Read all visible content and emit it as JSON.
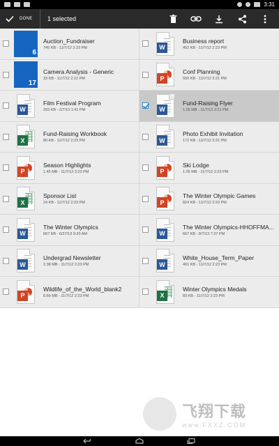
{
  "status_bar": {
    "time": "3:31",
    "icons": [
      "signal-icon",
      "cloud-icon",
      "sync-icon",
      "bluetooth-icon",
      "wifi-icon",
      "battery-icon"
    ]
  },
  "action_bar": {
    "done_label": "DONE",
    "selection_text": "1 selected",
    "actions": [
      "delete-icon",
      "link-icon",
      "download-icon",
      "share-icon",
      "overflow-menu-icon"
    ]
  },
  "files": [
    {
      "name": "Auction_Fundraiser",
      "meta": "745 KB - 11/7/12 2:23 PM",
      "type": "folder",
      "count": "6",
      "checked": false
    },
    {
      "name": "Business report",
      "meta": "452 KB - 11/7/12 2:23 PM",
      "type": "word",
      "checked": false
    },
    {
      "name": "Camera Analysis - Generic",
      "meta": "33 KB - 11/7/12 2:21 PM",
      "type": "folder",
      "count": "17",
      "checked": false
    },
    {
      "name": "Conf Planning",
      "meta": "550 KB - 11/7/12 2:21 PM",
      "type": "ppt",
      "checked": false
    },
    {
      "name": "Film Festival Program",
      "meta": "293 KB - 2/7/13 1:41 PM",
      "type": "word",
      "checked": false
    },
    {
      "name": "Fund-Raising Flyer",
      "meta": "1.05 MB - 11/7/12 2:21 PM",
      "type": "word",
      "checked": true
    },
    {
      "name": "Fund-Raising Workbook",
      "meta": "80 KB - 11/7/12 2:23 PM",
      "type": "excel",
      "checked": false
    },
    {
      "name": "Photo Exhibit Invitation",
      "meta": "172 KB - 11/7/12 2:21 PM",
      "type": "word",
      "checked": false
    },
    {
      "name": "Season Highlights",
      "meta": "1.45 MB - 11/7/12 2:23 PM",
      "type": "ppt",
      "checked": false
    },
    {
      "name": "Ski Lodge",
      "meta": "1.05 MB - 11/7/12 2:23 PM",
      "type": "ppt",
      "checked": false
    },
    {
      "name": "Sponsor List",
      "meta": "24 KB - 11/7/12 2:23 PM",
      "type": "excel",
      "checked": false
    },
    {
      "name": "The Winter Olympic Games",
      "meta": "824 KB - 11/7/12 2:23 PM",
      "type": "ppt",
      "checked": false
    },
    {
      "name": "The Winter Olympics",
      "meta": "667 KB - 6/27/13 9:20 AM",
      "type": "word",
      "checked": false
    },
    {
      "name": "The Winter Olympics-HHOFFMA...",
      "meta": "667 KB - 8/7/13 7:27 PM",
      "type": "word",
      "checked": false
    },
    {
      "name": "Undergrad Newsletter",
      "meta": "2.38 MB - 11/7/12 2:23 PM",
      "type": "word",
      "checked": false
    },
    {
      "name": "White_House_Term_Paper",
      "meta": "401 KB - 11/7/12 2:23 PM",
      "type": "word",
      "checked": false
    },
    {
      "name": "Wildlife_of_the_World_blank2",
      "meta": "8.66 MB - 11/7/12 2:23 PM",
      "type": "ppt",
      "checked": false
    },
    {
      "name": "Winter Olympics Medals",
      "meta": "83 KB - 11/7/12 2:23 PM",
      "type": "excel",
      "checked": false
    }
  ],
  "nav_bar": {
    "buttons": [
      "back-icon",
      "home-icon",
      "recents-icon"
    ]
  },
  "watermark": {
    "main": "飞翔下载",
    "sub": "www.FXXZ.COM"
  },
  "colors": {
    "action_bar": "#2a2a2a",
    "selected_row": "#c9c9c9",
    "checkbox_accent": "#2a8fd4",
    "folder": "#1565c0",
    "word": "#2b5797",
    "excel": "#1e7145",
    "ppt": "#d04525"
  }
}
